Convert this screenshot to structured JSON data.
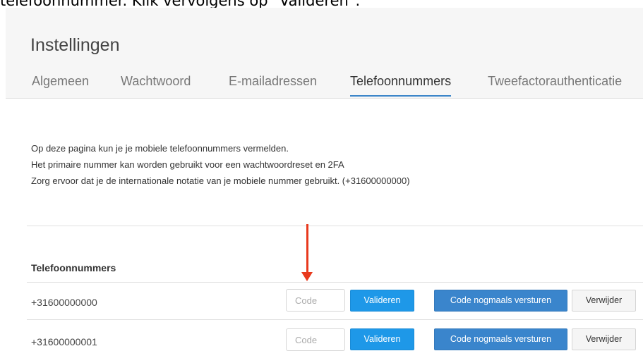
{
  "caption": "telefoonnummer. Klik vervolgens op \"Valideren\".",
  "header": {
    "title": "Instellingen",
    "tabs": [
      "Algemeen",
      "Wachtwoord",
      "E-mailadressen",
      "Telefoonnummers",
      "Tweefactorauthenticatie"
    ],
    "active_tab": "Telefoonnummers"
  },
  "intro": {
    "line1": "Op deze pagina kun je je mobiele telefoonnummers vermelden.",
    "line2": "Het primaire nummer kan worden gebruikt voor een wachtwoordreset en 2FA",
    "line3": "Zorg ervoor dat je de internationale notatie van je mobiele nummer gebruikt. (+31600000000)"
  },
  "phones": {
    "section_title": "Telefoonnummers",
    "code_placeholder": "Code",
    "validate_label": "Valideren",
    "resend_label": "Code nogmaals versturen",
    "remove_label": "Verwijder",
    "numbers": [
      "+31600000000",
      "+31600000001"
    ]
  },
  "annotation": {
    "arrow_color": "#e8391d"
  },
  "colors": {
    "accent": "#3b86c9",
    "validate_button": "#1e98e8",
    "resend_button": "#3a85cc"
  }
}
